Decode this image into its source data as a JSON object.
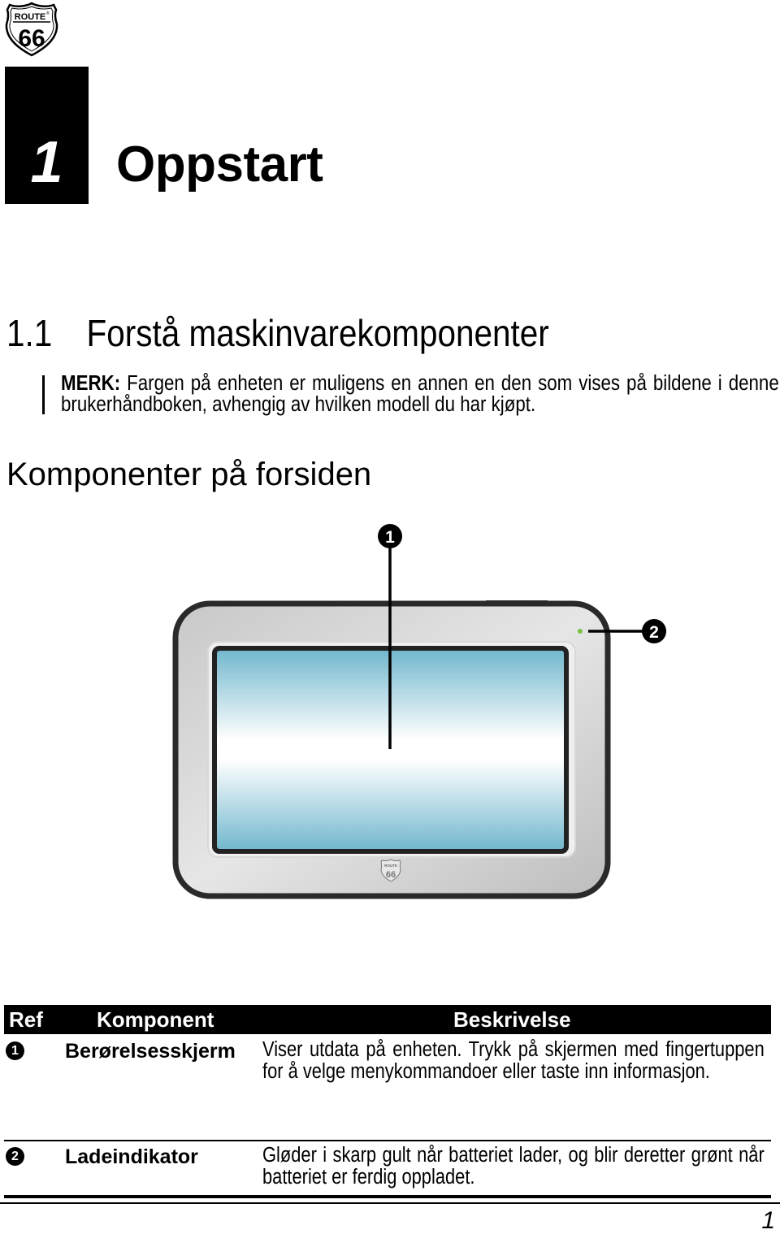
{
  "logo": {
    "icon": "route-66-shield-icon",
    "top_text": "ROUTE",
    "registered": "®",
    "number": "66"
  },
  "chapter": {
    "number": "1",
    "title": "Oppstart"
  },
  "section": {
    "number": "1.1",
    "title": "Forstå maskinvarekomponenter"
  },
  "note": {
    "label": "MERK:",
    "text": " Fargen på enheten er muligens en annen en den som vises på bildene i denne brukerhåndboken, avhengig av hvilken modell du har kjøpt."
  },
  "subheading": "Komponenter på forsiden",
  "figure": {
    "callouts": [
      {
        "number": "1",
        "target": "touch-screen"
      },
      {
        "number": "2",
        "target": "charge-indicator"
      }
    ],
    "indicator_color": "#7ac143",
    "bezel_logo": "route-66-shield-icon"
  },
  "table": {
    "headers": {
      "ref": "Ref",
      "component": "Komponent",
      "description": "Beskrivelse"
    },
    "rows": [
      {
        "ref": "1",
        "component": "Berørelsesskjerm",
        "description": "Viser utdata på enheten. Trykk på skjermen med fingertuppen for å velge menykommandoer eller taste inn informasjon."
      },
      {
        "ref": "2",
        "component": "Ladeindikator",
        "description": "Gløder i skarp gult når batteriet lader, og blir deretter grønt når batteriet er ferdig oppladet."
      }
    ]
  },
  "footer": {
    "page_number": "1"
  }
}
